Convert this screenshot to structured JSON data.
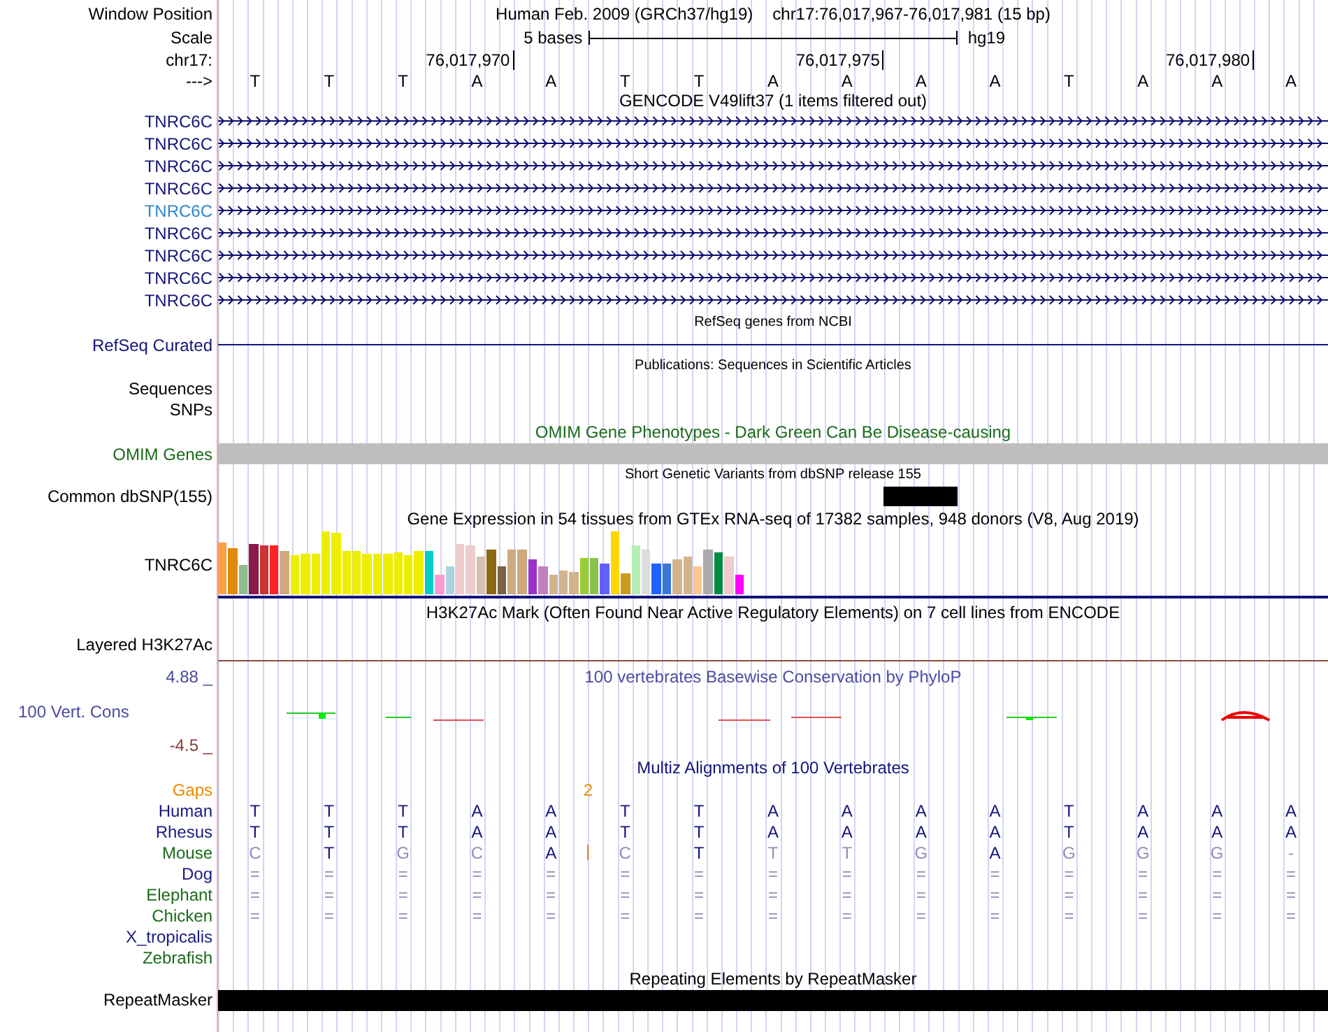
{
  "window_position": {
    "label": "Window Position",
    "assembly": "Human Feb. 2009 (GRCh37/hg19)",
    "range": "chr17:76,017,967-76,017,981 (15 bp)"
  },
  "scale": {
    "label": "Scale",
    "size": "5 bases",
    "build": "hg19"
  },
  "ruler": {
    "label": "chr17:",
    "ticks": [
      "76,017,970",
      "76,017,975",
      "76,017,980"
    ]
  },
  "sequence": {
    "label": "--->",
    "bases": [
      "T",
      "T",
      "T",
      "A",
      "A",
      "T",
      "T",
      "A",
      "A",
      "A",
      "A",
      "T",
      "A",
      "A",
      "A"
    ]
  },
  "gencode": {
    "title": "GENCODE V49lift37 (1 items filtered out)",
    "items": [
      {
        "label": "TNRC6C",
        "highlighted": false
      },
      {
        "label": "TNRC6C",
        "highlighted": false
      },
      {
        "label": "TNRC6C",
        "highlighted": false
      },
      {
        "label": "TNRC6C",
        "highlighted": false
      },
      {
        "label": "TNRC6C",
        "highlighted": true
      },
      {
        "label": "TNRC6C",
        "highlighted": false
      },
      {
        "label": "TNRC6C",
        "highlighted": false
      },
      {
        "label": "TNRC6C",
        "highlighted": false
      },
      {
        "label": "TNRC6C",
        "highlighted": false
      }
    ]
  },
  "refseq": {
    "title": "RefSeq genes from NCBI",
    "label": "RefSeq Curated"
  },
  "publications": {
    "title": "Publications: Sequences in Scientific Articles",
    "labels": [
      "Sequences",
      "SNPs"
    ]
  },
  "omim": {
    "title": "OMIM Gene Phenotypes - Dark Green Can Be Disease-causing",
    "label": "OMIM Genes"
  },
  "dbsnp": {
    "title": "Short Genetic Variants from dbSNP release 155",
    "label": "Common dbSNP(155)"
  },
  "gtex": {
    "title": "Gene Expression in 54 tissues from GTEx RNA-seq of 17382 samples, 948 donors (V8, Aug 2019)",
    "label": "TNRC6C"
  },
  "h3k27ac": {
    "title": "H3K27Ac Mark (Often Found Near Active Regulatory Elements) on 7 cell lines from ENCODE",
    "label": "Layered H3K27Ac"
  },
  "conservation": {
    "title": "100 vertebrates Basewise Conservation by PhyloP",
    "label": "100 Vert. Cons",
    "ymax": "4.88 _",
    "ymin": "-4.5 _"
  },
  "multiz": {
    "title": "Multiz Alignments of 100 Vertebrates",
    "gaps_label": "Gaps",
    "gap_count": "2",
    "species": [
      {
        "name": "Human",
        "color": "#1a1a80",
        "insertion": false,
        "bases": [
          "T",
          "T",
          "T",
          "A",
          "A",
          "T",
          "T",
          "A",
          "A",
          "A",
          "A",
          "T",
          "A",
          "A",
          "A"
        ]
      },
      {
        "name": "Rhesus",
        "color": "#1a1a80",
        "insertion": false,
        "bases": [
          "T",
          "T",
          "T",
          "A",
          "A",
          "T",
          "T",
          "A",
          "A",
          "A",
          "A",
          "T",
          "A",
          "A",
          "A"
        ]
      },
      {
        "name": "Mouse",
        "color": "#1a6b1a",
        "insertion": true,
        "bases": [
          "C",
          "T",
          "G",
          "C",
          "A",
          "C",
          "T",
          "T",
          "T",
          "G",
          "A",
          "G",
          "G",
          "G",
          "-"
        ]
      },
      {
        "name": "Dog",
        "color": "#1a1a80",
        "insertion": false,
        "bases": [
          "=",
          "=",
          "=",
          "=",
          "=",
          "=",
          "=",
          "=",
          "=",
          "=",
          "=",
          "=",
          "=",
          "=",
          "="
        ]
      },
      {
        "name": "Elephant",
        "color": "#1a6b1a",
        "insertion": false,
        "bases": [
          "=",
          "=",
          "=",
          "=",
          "=",
          "=",
          "=",
          "=",
          "=",
          "=",
          "=",
          "=",
          "=",
          "=",
          "="
        ]
      },
      {
        "name": "Chicken",
        "color": "#1a6b1a",
        "insertion": false,
        "bases": [
          "=",
          "=",
          "=",
          "=",
          "=",
          "=",
          "=",
          "=",
          "=",
          "=",
          "=",
          "=",
          "=",
          "=",
          "="
        ]
      },
      {
        "name": "X_tropicalis",
        "color": "#1a1a80",
        "insertion": false
      },
      {
        "name": "Zebrafish",
        "color": "#1a6b1a",
        "insertion": false
      }
    ]
  },
  "repeatmasker": {
    "title": "Repeating Elements by RepeatMasker",
    "label": "RepeatMasker"
  }
}
